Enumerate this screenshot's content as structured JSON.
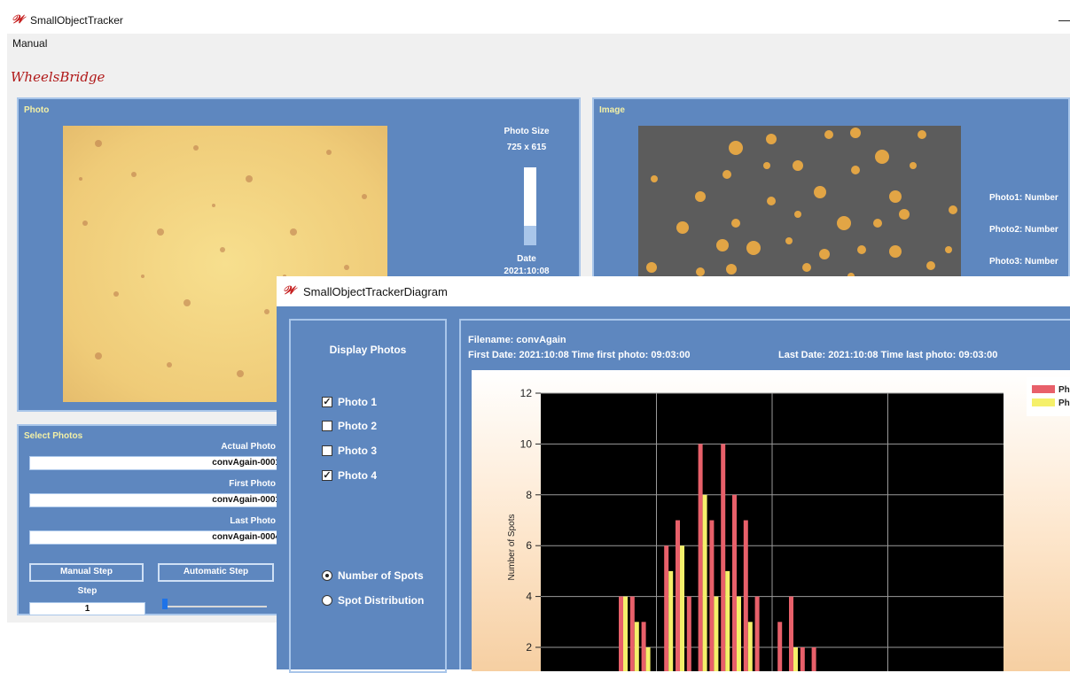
{
  "main_window": {
    "title": "SmallObjectTracker",
    "minimize_glyph": "—",
    "menu": [
      "Manual"
    ],
    "logo_text": "WheelsBridge",
    "photo_panel": {
      "title": "Photo",
      "photo_size_label": "Photo Size",
      "photo_size_value": "725 x 615",
      "date_label": "Date",
      "date_value": "2021:10:08",
      "scroll_level": 0.25
    },
    "image_panel": {
      "title": "Image",
      "labels": [
        "Photo1: Number",
        "Photo2: Number",
        "Photo3: Number"
      ]
    },
    "select_panel": {
      "title": "Select Photos",
      "actual_label": "Actual Photo",
      "actual_value": "convAgain-0001",
      "first_label": "First Photo",
      "first_value": "convAgain-0001",
      "last_label": "Last Photo",
      "last_value": "convAgain-0004",
      "manual_step_button": "Manual Step",
      "automatic_step_button": "Automatic Step",
      "step_label": "Step",
      "step_value": "1"
    }
  },
  "diagram_window": {
    "title": "SmallObjectTrackerDiagram",
    "display_title": "Display Photos",
    "checkboxes": [
      {
        "label": "Photo 1",
        "checked": true
      },
      {
        "label": "Photo 2",
        "checked": false
      },
      {
        "label": "Photo 3",
        "checked": false
      },
      {
        "label": "Photo 4",
        "checked": true
      }
    ],
    "radios": [
      {
        "label": "Number of Spots",
        "selected": true
      },
      {
        "label": "Spot Distribution",
        "selected": false
      }
    ],
    "filename_line": "Filename: convAgain",
    "first_line": "First Date: 2021:10:08 Time first photo: 09:03:00",
    "last_line": "Last Date: 2021:10:08 Time last photo: 09:03:00",
    "legend_visible": [
      "Ph",
      "Ph"
    ]
  },
  "chart_data": {
    "type": "bar",
    "ylabel": "Number of Spots",
    "ylim": [
      0,
      12
    ],
    "yticks": [
      2,
      4,
      6,
      8,
      10,
      12
    ],
    "grid": true,
    "legend": "top-right",
    "series": [
      {
        "color": "#e8606a",
        "values": [
          4,
          4,
          3,
          0,
          6,
          7,
          4,
          10,
          7,
          10,
          8,
          7,
          4,
          0,
          3,
          4,
          2,
          2
        ]
      },
      {
        "color": "#f5f06a",
        "values": [
          4,
          3,
          2,
          0,
          5,
          6,
          0,
          8,
          4,
          5,
          4,
          3,
          0,
          0,
          0,
          2,
          0,
          0
        ]
      }
    ]
  },
  "colors": {
    "panel": "#5e87bf",
    "panel_border": "#a9c6ea",
    "panel_title": "#f3f0a6",
    "plot_bg": "#000000"
  }
}
